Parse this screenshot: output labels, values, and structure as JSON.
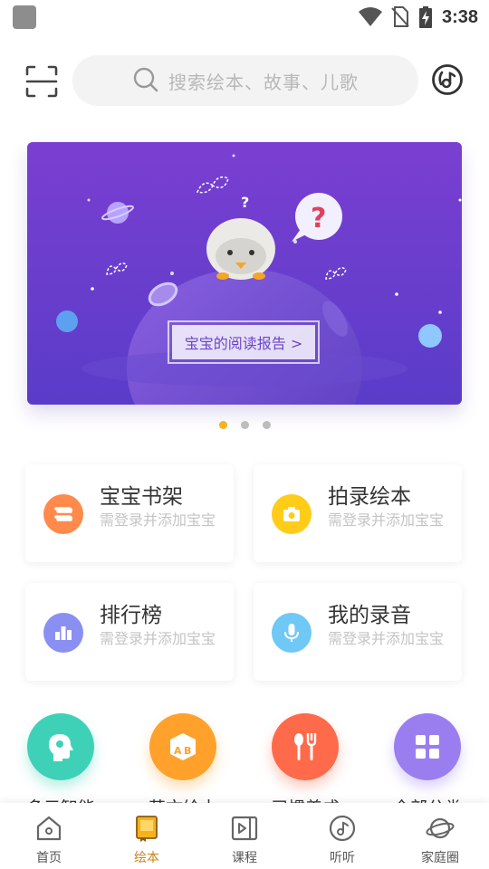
{
  "status_bar": {
    "time": "3:38",
    "icons": [
      "app-icon",
      "wifi-icon",
      "no-sim-icon",
      "battery-charging-icon"
    ]
  },
  "header": {
    "scan_icon": "scan-icon",
    "search": {
      "placeholder": "搜索绘本、故事、儿歌",
      "icon": "search-icon"
    },
    "music_icon": "music-disc-icon"
  },
  "banner": {
    "button_label": "宝宝的阅读报告 >",
    "page_count": 3,
    "active_page": 1,
    "colors": {
      "bg_top": "#7a3fd1",
      "bg_bottom": "#5a3cc9"
    }
  },
  "cards": [
    {
      "title": "宝宝书架",
      "subtitle": "需登录并添加宝宝",
      "icon": "bookshelf-icon",
      "color": "#ff8a4c"
    },
    {
      "title": "拍录绘本",
      "subtitle": "需登录并添加宝宝",
      "icon": "camera-icon",
      "color": "#ffcc1a"
    },
    {
      "title": "排行榜",
      "subtitle": "需登录并添加宝宝",
      "icon": "ranking-icon",
      "color": "#8a8ff2"
    },
    {
      "title": "我的录音",
      "subtitle": "需登录并添加宝宝",
      "icon": "microphone-icon",
      "color": "#6fc8f5"
    }
  ],
  "categories": [
    {
      "label": "多元智能",
      "icon": "head-icon",
      "color": "#3fd1b8"
    },
    {
      "label": "英文绘本",
      "icon": "abc-cube-icon",
      "color": "#ffa12b"
    },
    {
      "label": "习惯养成",
      "icon": "spoon-fork-icon",
      "color": "#ff6a4a"
    },
    {
      "label": "全部分类",
      "icon": "grid-icon",
      "color": "#9a7ef0"
    }
  ],
  "bottom_nav": [
    {
      "label": "首页",
      "icon": "home-icon",
      "active": false
    },
    {
      "label": "绘本",
      "icon": "book-icon",
      "active": true
    },
    {
      "label": "课程",
      "icon": "video-icon",
      "active": false
    },
    {
      "label": "听听",
      "icon": "music-note-icon",
      "active": false
    },
    {
      "label": "家庭圈",
      "icon": "planet-icon",
      "active": false
    }
  ],
  "accent_color": "#f5b21c"
}
